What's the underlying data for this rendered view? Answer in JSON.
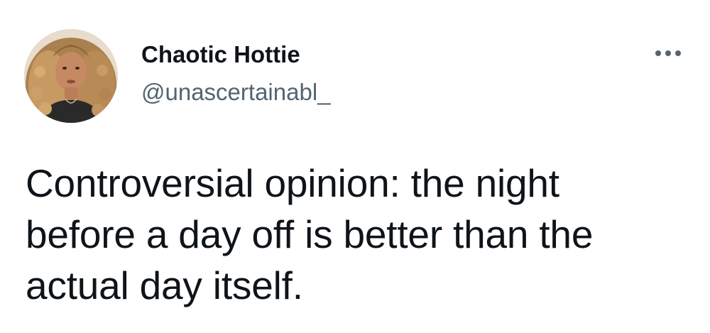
{
  "tweet": {
    "author": {
      "display_name": "Chaotic Hottie",
      "handle": "@unascertainabl_"
    },
    "text": "Controversial opinion: the night before a day off is better than the actual day itself.",
    "more_icon": "more-horizontal-icon"
  },
  "colors": {
    "primary_text": "#0f1419",
    "secondary_text": "#536471",
    "background": "#ffffff"
  }
}
